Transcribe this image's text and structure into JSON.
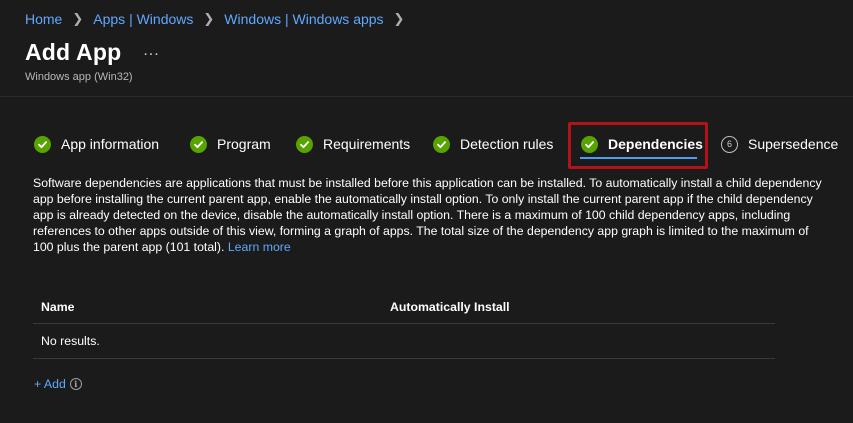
{
  "breadcrumb": [
    "Home",
    "Apps | Windows",
    "Windows | Windows apps"
  ],
  "page": {
    "title": "Add App",
    "more": "...",
    "subtitle": "Windows app (Win32)"
  },
  "tabs": [
    {
      "label": "App information",
      "status": "done"
    },
    {
      "label": "Program",
      "status": "done"
    },
    {
      "label": "Requirements",
      "status": "done"
    },
    {
      "label": "Detection rules",
      "status": "done"
    },
    {
      "label": "Dependencies",
      "status": "done",
      "active": true
    },
    {
      "label": "Supersedence",
      "status": "pending",
      "number": "6"
    }
  ],
  "description": {
    "text": "Software dependencies are applications that must be installed before this application can be installed. To automatically install a child dependency app before installing the current parent app, enable the automatically install option. To only install the current parent app if the child dependency app is already detected on the device, disable the automatically install option. There is a maximum of 100 child dependency apps, including references to other apps outside of this view, forming a graph of apps. The total size of the dependency app graph is limited to the maximum of 100 plus the parent app (101 total).",
    "link": "Learn more"
  },
  "table": {
    "columns": [
      "Name",
      "Automatically Install"
    ],
    "empty_text": "No results."
  },
  "add": {
    "label": "+ Add",
    "info": "i"
  },
  "colors": {
    "background": "#1b1b1b",
    "link": "#5fa8ff",
    "check": "#57a300",
    "active_underline": "#4a9cf5",
    "highlight": "#b3121b"
  }
}
